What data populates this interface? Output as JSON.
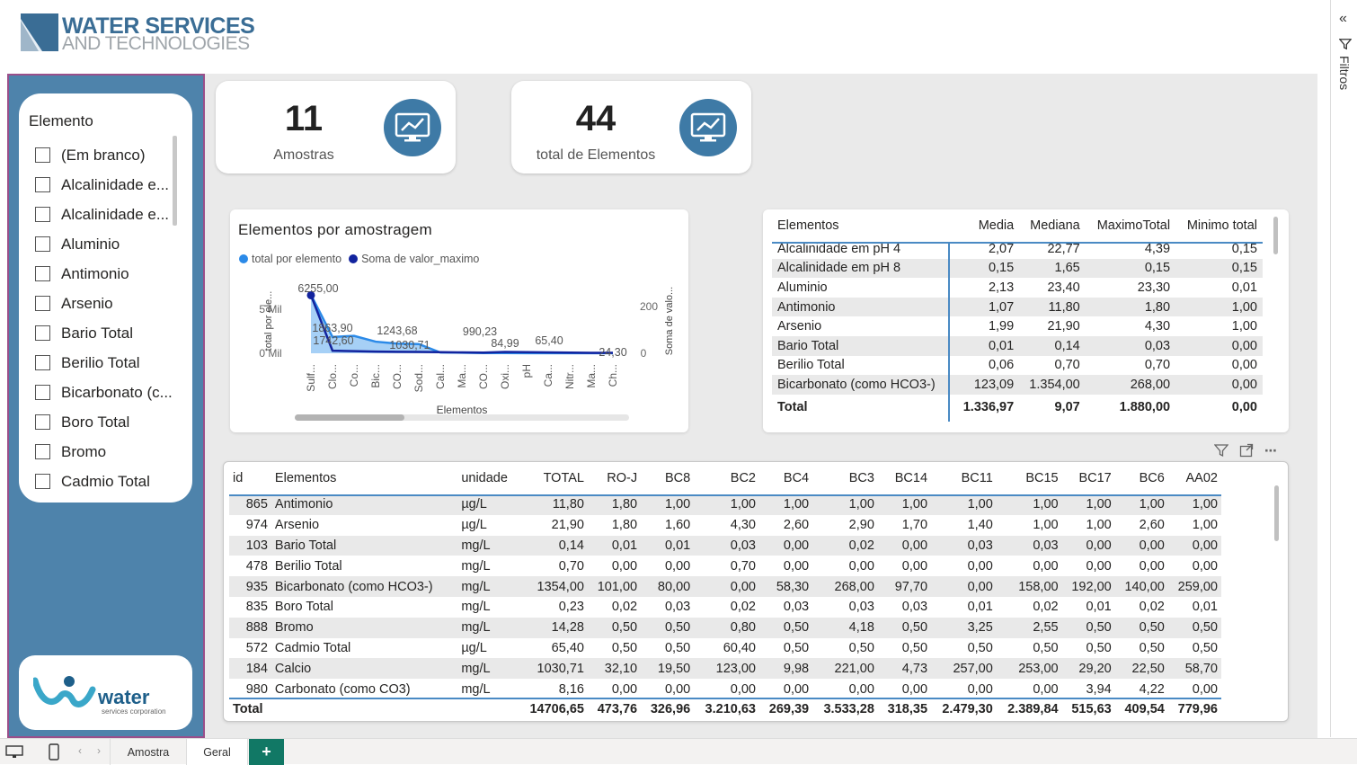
{
  "header": {
    "logo_line1": "WATER SERVICES",
    "logo_line2": "AND TECHNOLOGIES"
  },
  "slicer": {
    "title": "Elemento",
    "items": [
      "(Em branco)",
      "Alcalinidade e...",
      "Alcalinidade e...",
      "Aluminio",
      "Antimonio",
      "Arsenio",
      "Bario Total",
      "Berilio Total",
      "Bicarbonato (c...",
      "Boro Total",
      "Bromo",
      "Cadmio Total"
    ]
  },
  "bottom_logo": {
    "word": "water",
    "sub": "services corporation"
  },
  "cards": [
    {
      "value": "11",
      "label": "Amostras"
    },
    {
      "value": "44",
      "label": "total de Elementos"
    }
  ],
  "chart_data": {
    "type": "line",
    "title": "Elementos por amostragem",
    "legend": [
      "total por elemento",
      "Soma de valor_maximo"
    ],
    "xlabel": "Elementos",
    "ylabel_left": "total por ele...",
    "ylabel_right": "Soma de valo...",
    "yticks_left": [
      "5 Mil",
      "0 Mil"
    ],
    "yticks_right": [
      "200",
      "0"
    ],
    "categories": [
      "Sulf...",
      "Clo...",
      "Co...",
      "Bic...",
      "CO...",
      "Sod...",
      "Cal...",
      "Ma...",
      "CO...",
      "Oxi...",
      "pH",
      "Ca...",
      "Nitr...",
      "Ma...",
      "Ch..."
    ],
    "series": [
      {
        "name": "total por elemento",
        "values": [
          6255,
          1742.6,
          1863.9,
          1243.68,
          1030.71,
          990.23,
          84.99,
          65.4,
          24.3,
          20,
          18,
          15,
          12,
          10,
          8
        ]
      },
      {
        "name": "Soma de valor_maximo",
        "values": [
          268,
          12,
          10,
          8,
          7,
          6,
          5,
          4,
          3,
          6,
          5,
          4,
          3,
          2,
          2
        ]
      }
    ],
    "data_labels": [
      "6255,00",
      "1742,60",
      "1863,90",
      "1243,68",
      "1030,71",
      "990,23",
      "84,99",
      "65,40",
      "24,30"
    ],
    "colors": {
      "area": "#9ccbf5",
      "line": "#2b8ae8",
      "dark": "#12239e"
    }
  },
  "summary_table": {
    "headers": [
      "Elementos",
      "Media",
      "Mediana",
      "MaximoTotal",
      "Minimo total"
    ],
    "rows": [
      [
        "Alcalinidade em pH 4",
        "2,07",
        "22,77",
        "4,39",
        "0,15"
      ],
      [
        "Alcalinidade em pH 8",
        "0,15",
        "1,65",
        "0,15",
        "0,15"
      ],
      [
        "Aluminio",
        "2,13",
        "23,40",
        "23,30",
        "0,01"
      ],
      [
        "Antimonio",
        "1,07",
        "11,80",
        "1,80",
        "1,00"
      ],
      [
        "Arsenio",
        "1,99",
        "21,90",
        "4,30",
        "1,00"
      ],
      [
        "Bario Total",
        "0,01",
        "0,14",
        "0,03",
        "0,00"
      ],
      [
        "Berilio Total",
        "0,06",
        "0,70",
        "0,70",
        "0,00"
      ],
      [
        "Bicarbonato (como HCO3-)",
        "123,09",
        "1.354,00",
        "268,00",
        "0,00"
      ]
    ],
    "total": [
      "Total",
      "1.336,97",
      "9,07",
      "1.880,00",
      "0,00"
    ]
  },
  "detail_table": {
    "headers": [
      "id",
      "Elementos",
      "unidade",
      "TOTAL",
      "RO-J",
      "BC8",
      "BC2",
      "BC4",
      "BC3",
      "BC14",
      "BC11",
      "BC15",
      "BC17",
      "BC6",
      "AA02"
    ],
    "rows": [
      [
        "865",
        "Antimonio",
        "µg/L",
        "11,80",
        "1,80",
        "1,00",
        "1,00",
        "1,00",
        "1,00",
        "1,00",
        "1,00",
        "1,00",
        "1,00",
        "1,00",
        "1,00"
      ],
      [
        "974",
        "Arsenio",
        "µg/L",
        "21,90",
        "1,80",
        "1,60",
        "4,30",
        "2,60",
        "2,90",
        "1,70",
        "1,40",
        "1,00",
        "1,00",
        "2,60",
        "1,00"
      ],
      [
        "103",
        "Bario Total",
        "mg/L",
        "0,14",
        "0,01",
        "0,01",
        "0,03",
        "0,00",
        "0,02",
        "0,00",
        "0,03",
        "0,03",
        "0,00",
        "0,00",
        "0,00"
      ],
      [
        "478",
        "Berilio Total",
        "mg/L",
        "0,70",
        "0,00",
        "0,00",
        "0,70",
        "0,00",
        "0,00",
        "0,00",
        "0,00",
        "0,00",
        "0,00",
        "0,00",
        "0,00"
      ],
      [
        "935",
        "Bicarbonato (como HCO3-)",
        "mg/L",
        "1354,00",
        "101,00",
        "80,00",
        "0,00",
        "58,30",
        "268,00",
        "97,70",
        "0,00",
        "158,00",
        "192,00",
        "140,00",
        "259,00"
      ],
      [
        "835",
        "Boro Total",
        "mg/L",
        "0,23",
        "0,02",
        "0,03",
        "0,02",
        "0,03",
        "0,03",
        "0,03",
        "0,01",
        "0,02",
        "0,01",
        "0,02",
        "0,01"
      ],
      [
        "888",
        "Bromo",
        "mg/L",
        "14,28",
        "0,50",
        "0,50",
        "0,80",
        "0,50",
        "4,18",
        "0,50",
        "3,25",
        "2,55",
        "0,50",
        "0,50",
        "0,50"
      ],
      [
        "572",
        "Cadmio Total",
        "µg/L",
        "65,40",
        "0,50",
        "0,50",
        "60,40",
        "0,50",
        "0,50",
        "0,50",
        "0,50",
        "0,50",
        "0,50",
        "0,50",
        "0,50"
      ],
      [
        "184",
        "Calcio",
        "mg/L",
        "1030,71",
        "32,10",
        "19,50",
        "123,00",
        "9,98",
        "221,00",
        "4,73",
        "257,00",
        "253,00",
        "29,20",
        "22,50",
        "58,70"
      ],
      [
        "980",
        "Carbonato (como CO3)",
        "mg/L",
        "8,16",
        "0,00",
        "0,00",
        "0,00",
        "0,00",
        "0,00",
        "0,00",
        "0,00",
        "0,00",
        "3,94",
        "4,22",
        "0,00"
      ]
    ],
    "total": [
      "Total",
      "",
      "",
      "14706,65",
      "473,76",
      "326,96",
      "3.210,63",
      "269,39",
      "3.533,28",
      "318,35",
      "2.479,30",
      "2.389,84",
      "515,63",
      "409,54",
      "779,96"
    ]
  },
  "right_pane": {
    "label": "Filtros"
  },
  "tabs": {
    "pages": [
      "Amostra",
      "Geral"
    ],
    "add": "+"
  }
}
